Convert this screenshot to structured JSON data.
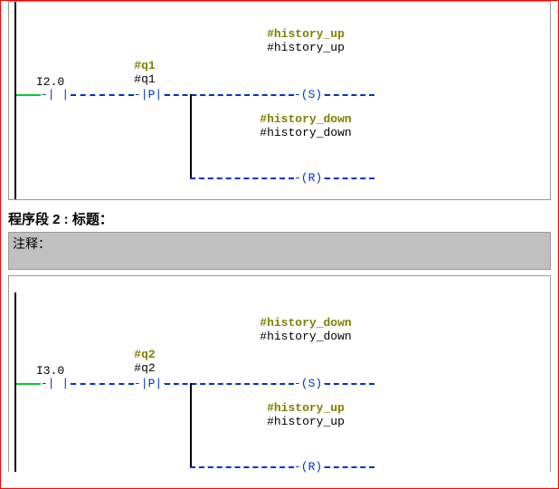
{
  "net1": {
    "input_addr": "I2.0",
    "edge": {
      "tag": "#q1",
      "name": "#q1",
      "type": "P"
    },
    "coilA": {
      "tag": "#history_up",
      "name": "#history_up",
      "type": "S"
    },
    "coilB": {
      "tag": "#history_down",
      "name": "#history_down",
      "type": "R"
    }
  },
  "separator": {
    "title": "程序段 2 : 标题：",
    "comment_label": "注释："
  },
  "net2": {
    "input_addr": "I3.0",
    "edge": {
      "tag": "#q2",
      "name": "#q2",
      "type": "P"
    },
    "coilA": {
      "tag": "#history_down",
      "name": "#history_down",
      "type": "S"
    },
    "coilB": {
      "tag": "#history_up",
      "name": "#history_up",
      "type": "R"
    }
  }
}
